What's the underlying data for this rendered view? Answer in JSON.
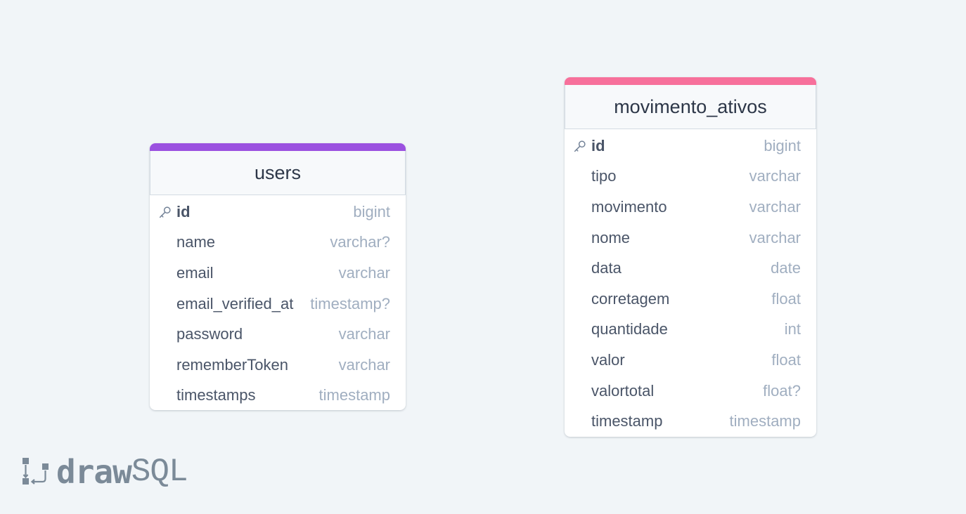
{
  "diagram": {
    "tables": [
      {
        "name": "users",
        "accent_color": "#9b51e0",
        "columns": [
          {
            "name": "id",
            "type": "bigint",
            "primary_key": true
          },
          {
            "name": "name",
            "type": "varchar?"
          },
          {
            "name": "email",
            "type": "varchar"
          },
          {
            "name": "email_verified_at",
            "type": "timestamp?"
          },
          {
            "name": "password",
            "type": "varchar"
          },
          {
            "name": "rememberToken",
            "type": "varchar"
          },
          {
            "name": "timestamps",
            "type": "timestamp"
          }
        ]
      },
      {
        "name": "movimento_ativos",
        "accent_color": "#f7709b",
        "columns": [
          {
            "name": "id",
            "type": "bigint",
            "primary_key": true
          },
          {
            "name": "tipo",
            "type": "varchar"
          },
          {
            "name": "movimento",
            "type": "varchar"
          },
          {
            "name": "nome",
            "type": "varchar"
          },
          {
            "name": "data",
            "type": "date"
          },
          {
            "name": "corretagem",
            "type": "float"
          },
          {
            "name": "quantidade",
            "type": "int"
          },
          {
            "name": "valor",
            "type": "float"
          },
          {
            "name": "valortotal",
            "type": "float?"
          },
          {
            "name": "timestamp",
            "type": "timestamp"
          }
        ]
      }
    ]
  },
  "logo": {
    "bold": "draw",
    "light": "SQL",
    "icon": "drawsql-logo-icon"
  }
}
